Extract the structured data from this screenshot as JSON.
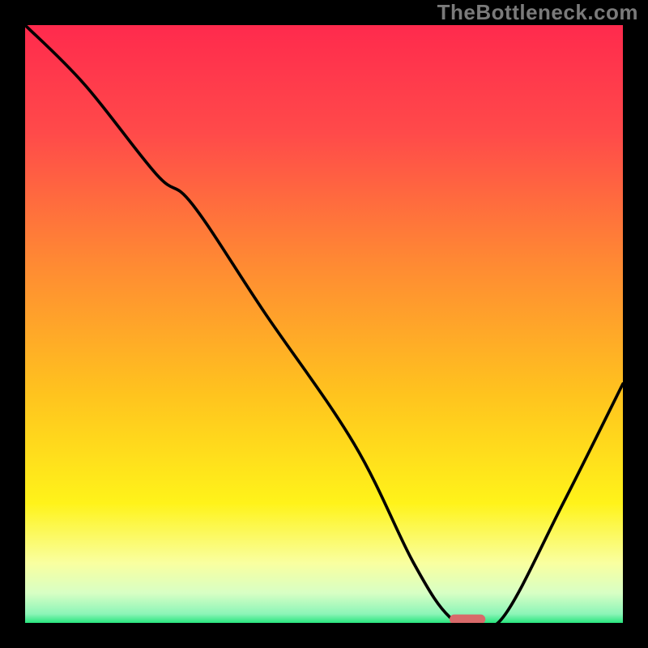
{
  "watermark": "TheBottleneck.com",
  "chart_data": {
    "type": "line",
    "title": "",
    "xlabel": "",
    "ylabel": "",
    "xlim": [
      0,
      100
    ],
    "ylim": [
      0,
      100
    ],
    "background_gradient_stops": [
      {
        "offset": 0.0,
        "color": "#ff2a4d"
      },
      {
        "offset": 0.18,
        "color": "#ff4a4a"
      },
      {
        "offset": 0.4,
        "color": "#ff8a33"
      },
      {
        "offset": 0.62,
        "color": "#ffc41e"
      },
      {
        "offset": 0.8,
        "color": "#fff31a"
      },
      {
        "offset": 0.9,
        "color": "#f9ffa0"
      },
      {
        "offset": 0.95,
        "color": "#d8ffc4"
      },
      {
        "offset": 0.985,
        "color": "#8cf5b8"
      },
      {
        "offset": 1.0,
        "color": "#29e57d"
      }
    ],
    "series": [
      {
        "name": "bottleneck-curve",
        "x": [
          0,
          10,
          22,
          28,
          40,
          55,
          65,
          71,
          75,
          80,
          90,
          100
        ],
        "y": [
          100,
          90,
          75,
          70,
          52,
          30,
          10,
          1,
          0.5,
          1,
          20,
          40
        ]
      }
    ],
    "marker": {
      "name": "match-marker",
      "x": 74,
      "y": 0.6,
      "color": "#d86a6a"
    }
  }
}
